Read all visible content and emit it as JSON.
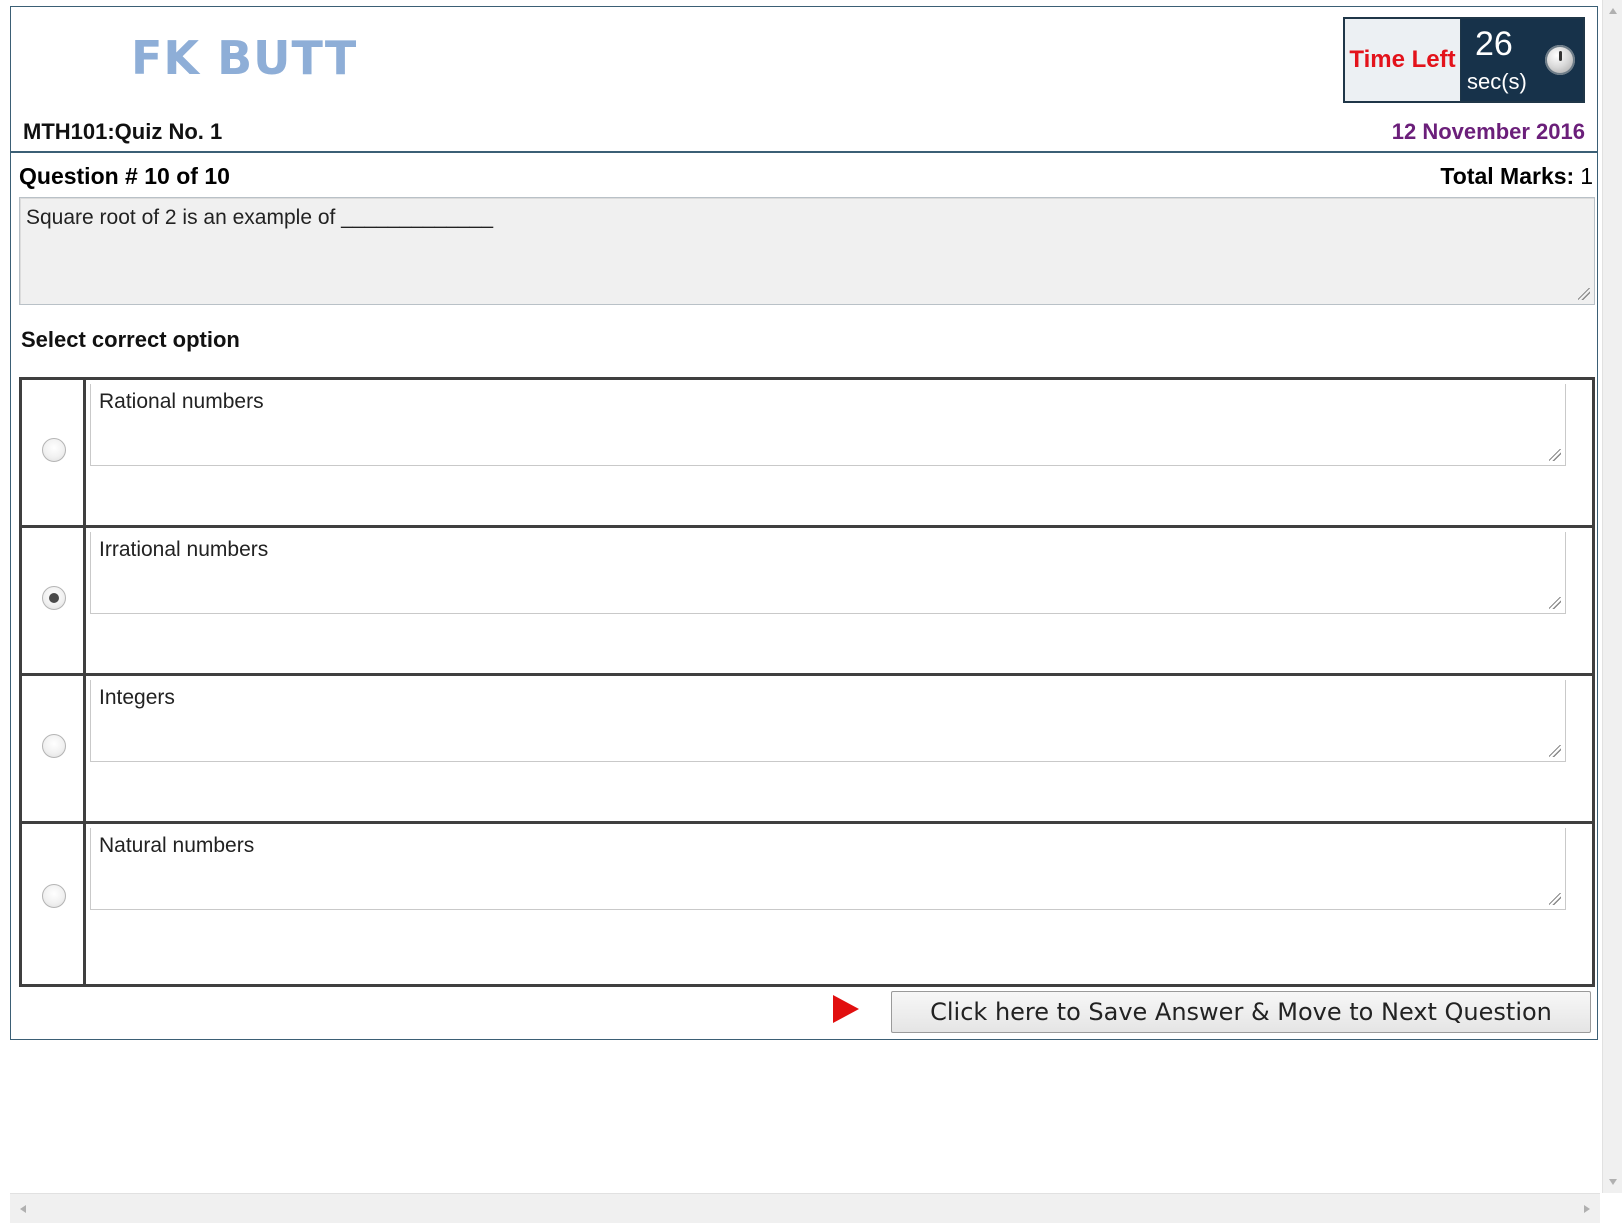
{
  "header": {
    "logo_text": "FK BUTT",
    "quiz_title": "MTH101:Quiz No. 1",
    "date": "12 November 2016",
    "timer": {
      "label": "Time Left",
      "seconds": "26",
      "unit": "sec(s)"
    }
  },
  "question": {
    "number_label": "Question # 10 of 10",
    "total_marks_label": "Total Marks:",
    "total_marks_value": "1",
    "text": "Square root of 2 is an example of _____________"
  },
  "options_label": "Select correct option",
  "options": [
    {
      "text": "Rational numbers",
      "selected": false
    },
    {
      "text": "Irrational numbers",
      "selected": true
    },
    {
      "text": "Integers",
      "selected": false
    },
    {
      "text": "Natural numbers",
      "selected": false
    }
  ],
  "footer": {
    "next_button_label": "Click here to Save Answer & Move to Next Question"
  },
  "colors": {
    "logo": "#8eaed7",
    "date": "#6b1f7a",
    "timer_label": "#e3131b",
    "timer_bg": "#17324a",
    "play_icon": "#e10f0f",
    "panel_border": "#3b5f75"
  },
  "icons": {
    "timer": "clock-icon",
    "next_arrow": "play-icon"
  }
}
